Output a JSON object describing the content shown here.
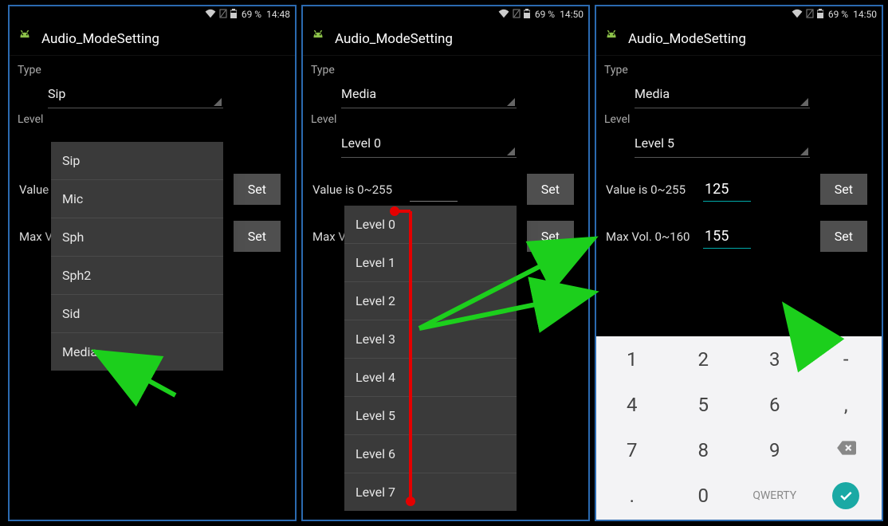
{
  "status": {
    "battery": "69 %",
    "time1": "14:48",
    "time2": "14:50",
    "time3": "14:50"
  },
  "appbar": {
    "title": "Audio_ModeSetting"
  },
  "labels": {
    "type": "Type",
    "level": "Level",
    "value": "Value is 0~255",
    "maxvol": "Max Vol. 0~160",
    "set": "Set"
  },
  "p1": {
    "type_sel": "Sip",
    "options": [
      "Sip",
      "Mic",
      "Sph",
      "Sph2",
      "Sid",
      "Media"
    ]
  },
  "p2": {
    "type_sel": "Media",
    "level_sel": "Level 0",
    "levels": [
      "Level 0",
      "Level 1",
      "Level 2",
      "Level 3",
      "Level 4",
      "Level 5",
      "Level 6",
      "Level 7"
    ]
  },
  "p3": {
    "type_sel": "Media",
    "level_sel": "Level 5",
    "value": "125",
    "maxvol": "155"
  },
  "keypad": {
    "keys": [
      [
        "1",
        "2",
        "3",
        "-"
      ],
      [
        "4",
        "5",
        "6",
        ","
      ],
      [
        "7",
        "8",
        "9",
        "bksp"
      ],
      [
        ".",
        "0",
        "QWERTY",
        "done"
      ]
    ]
  }
}
